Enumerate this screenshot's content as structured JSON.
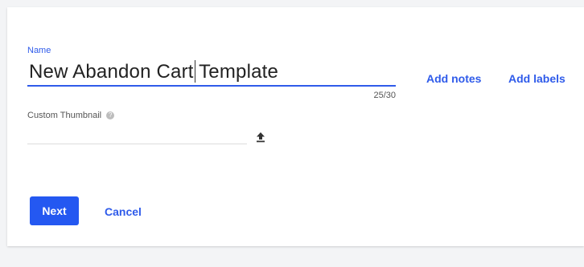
{
  "form": {
    "name_label": "Name",
    "name_value": "New Abandon Cart Template",
    "char_counter": "25/30",
    "add_notes": "Add notes",
    "add_labels": "Add labels",
    "thumbnail_label": "Custom Thumbnail",
    "thumbnail_help_glyph": "?",
    "thumbnail_value": "",
    "upload_icon": "upload-icon"
  },
  "actions": {
    "next": "Next",
    "cancel": "Cancel"
  },
  "colors": {
    "accent": "#2f5bea",
    "primary_button": "#2458f1",
    "background": "#f3f4f6",
    "card": "#ffffff"
  }
}
